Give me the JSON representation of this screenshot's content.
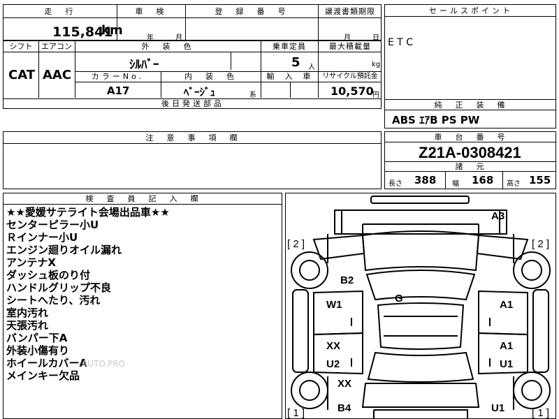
{
  "header": {
    "mileage_label": "走　行",
    "mileage_value": "115,841",
    "mileage_unit": "km",
    "inspection_label": "車　検",
    "inspection_year": "年",
    "inspection_month": "月",
    "registration_label": "登　録　番　号",
    "transfer_label": "譲渡書類期限",
    "transfer_month": "月",
    "transfer_day": "日"
  },
  "specs": {
    "shift_label": "シフト",
    "shift_value": "CAT",
    "aircon_label": "エアコン",
    "aircon_value": "AAC",
    "exterior_color_label": "外　装　色",
    "exterior_color_value": "ｼﾙﾊﾞｰ",
    "capacity_label": "乗車定員",
    "capacity_value": "5",
    "capacity_unit": "人",
    "max_load_label": "最大積載量",
    "max_load_unit": "kg",
    "color_no_label": "カラーNo.",
    "color_no_value": "A17",
    "interior_color_label": "内　装　色",
    "interior_color_value": "ﾍﾞｰｼﾞｭ",
    "interior_color_suffix": "系",
    "import_label": "輸　入　車",
    "recycle_label": "リサイクル預託金",
    "recycle_value": "10,570",
    "recycle_unit": "円",
    "later_parts_label": "後日発送部品"
  },
  "sales_point": {
    "label": "セールスポイント",
    "value": "E T C"
  },
  "genuine_equipment": {
    "label": "純　正　装　備",
    "value": "ABS  ｴｱB  PS  PW"
  },
  "caution": {
    "label": "注　意　事　項　欄"
  },
  "chassis": {
    "label": "車　台　番　号",
    "value": "Z21A-0308421",
    "dims_label": "諸　元",
    "length_label": "長さ",
    "length_value": "388",
    "width_label": "幅",
    "width_value": "168",
    "height_label": "高さ",
    "height_value": "155"
  },
  "inspector": {
    "label": "検　査　員　記　入　欄",
    "notes": [
      "★★愛媛サテライト会場出品車★★",
      "センターピラー小U",
      "Ｒインナー小U",
      "エンジン廻りオイル漏れ",
      "アンテナX",
      "ダッシュ板のり付",
      "ハンドルグリップ不良",
      "シートへたり、汚れ",
      "室内汚れ",
      "天張汚れ",
      "バンパー下A",
      "外装小傷有り",
      "ホイールカバーA",
      "メインキー欠品"
    ]
  },
  "diagram": {
    "marks": {
      "a3": "A3",
      "b2": "B2",
      "g": "G",
      "w1": "W1",
      "a1_front": "A1",
      "xx_left": "XX",
      "a1_rear": "A1",
      "u2": "U2",
      "u1_right": "U1",
      "xx_bottom": "XX",
      "b4": "B4",
      "u1_bottom": "U1"
    },
    "brackets": {
      "top_left": "[ 2 ]",
      "top_right": "[ 2 ]",
      "bottom_left": "[ 1 ]",
      "bottom_right": "[ 1 ]"
    }
  },
  "watermark": "AUTO.PRO"
}
